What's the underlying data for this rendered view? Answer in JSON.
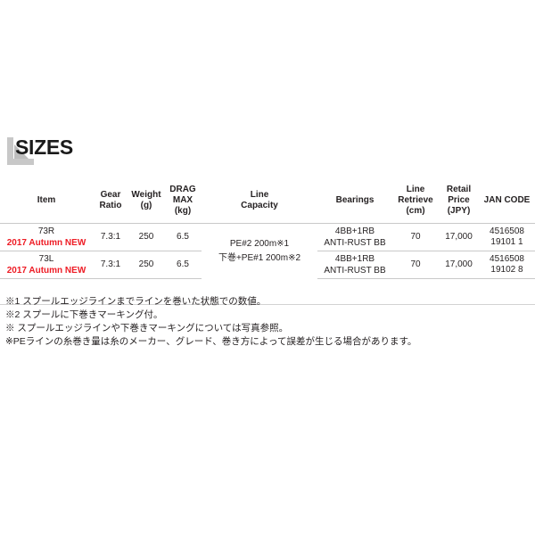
{
  "section": {
    "title": "SIZES",
    "arrow_icon": "corner-arrow-icon",
    "rule_color": "#d2d2d2"
  },
  "table": {
    "headers": [
      {
        "label": "Item"
      },
      {
        "label": "Gear\nRatio",
        "line1": "Gear",
        "line2": "Ratio"
      },
      {
        "label": "Weight\n(g)",
        "line1": "Weight",
        "line2": "(g)"
      },
      {
        "label": "DRAG\nMAX\n(kg)",
        "line1": "DRAG",
        "line2": "MAX",
        "line3": "(kg)"
      },
      {
        "label": "Line\nCapacity",
        "line1": "Line",
        "line2": "Capacity"
      },
      {
        "label": "Bearings"
      },
      {
        "label": "Line\nRetrieve\n(cm)",
        "line1": "Line",
        "line2": "Retrieve",
        "line3": "(cm)"
      },
      {
        "label": "Retail\nPrice\n(JPY)",
        "line1": "Retail",
        "line2": "Price",
        "line3": "(JPY)"
      },
      {
        "label": "JAN CODE"
      }
    ],
    "line_capacity": {
      "line1": "PE#2 200m※1",
      "line2": "下巻+PE#1 200m※2"
    },
    "rows": [
      {
        "item": "73R",
        "badge": "2017 Autumn NEW",
        "gear_ratio": "7.3:1",
        "weight": "250",
        "drag_max": "6.5",
        "bearings_line1": "4BB+1RB",
        "bearings_line2": "ANTI-RUST BB",
        "line_retrieve": "70",
        "retail_price": "17,000",
        "jan_code": "4516508 19101 1"
      },
      {
        "item": "73L",
        "badge": "2017 Autumn NEW",
        "gear_ratio": "7.3:1",
        "weight": "250",
        "drag_max": "6.5",
        "bearings_line1": "4BB+1RB",
        "bearings_line2": "ANTI-RUST BB",
        "line_retrieve": "70",
        "retail_price": "17,000",
        "jan_code": "4516508 19102 8"
      }
    ],
    "badge_color": "#ee1c25",
    "border_color": "#c9c9c9"
  },
  "footnotes": [
    "※1 スプールエッジラインまでラインを巻いた状態での数値。",
    "※2 スプールに下巻きマーキング付。",
    "※ スプールエッジラインや下巻きマーキングについては写真参照。",
    "※PEラインの糸巻き量は糸のメーカー、グレード、巻き方によって誤差が生じる場合があります。"
  ]
}
